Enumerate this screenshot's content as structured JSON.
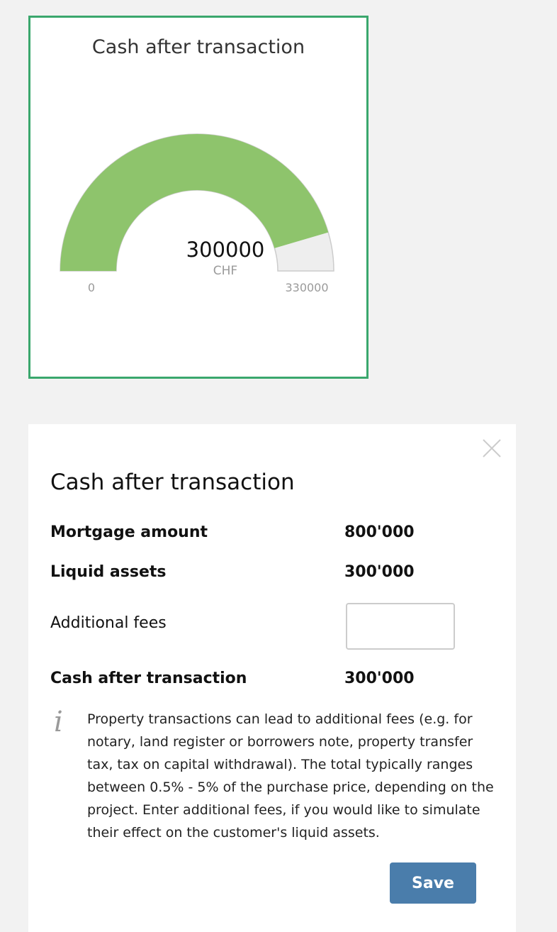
{
  "gauge_card": {
    "title": "Cash after transaction",
    "value_text": "300000",
    "unit": "CHF",
    "min_label": "0",
    "max_label": "330000"
  },
  "chart_data": {
    "type": "gauge",
    "title": "Cash after transaction",
    "value": 300000,
    "min": 0,
    "max": 330000,
    "unit": "CHF",
    "colors": {
      "fill": "#8ec46c",
      "track": "#eeeeee",
      "track_border": "#cccccc"
    }
  },
  "panel": {
    "title": "Cash after transaction",
    "rows": [
      {
        "label": "Mortgage amount",
        "value": "800'000"
      },
      {
        "label": "Liquid assets",
        "value": "300'000"
      },
      {
        "label": "Additional fees",
        "value": ""
      },
      {
        "label": "Cash after transaction",
        "value": "300'000"
      }
    ],
    "fees_input": {
      "value": "",
      "placeholder": ""
    },
    "info_icon": "info-icon",
    "info_text": "Property transactions can lead to additional fees (e.g. for notary, land register or borrowers note, property transfer tax, tax on capital withdrawal). The total typically ranges between 0.5% - 5% of the purchase price, depending on the project. Enter additional fees, if you would like to simulate their effect on the customer's liquid assets.",
    "save_label": "Save",
    "close_icon": "close-icon"
  },
  "colors": {
    "card_border": "#3aa76d",
    "save_button": "#4a7dab",
    "background": "#f2f2f2"
  }
}
